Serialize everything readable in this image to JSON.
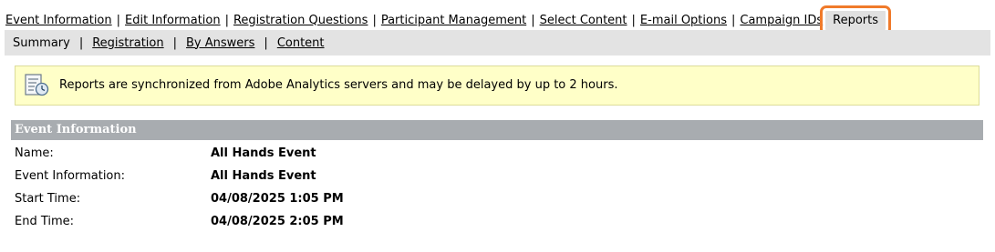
{
  "top_nav": {
    "items": [
      {
        "label": "Event Information"
      },
      {
        "label": "Edit Information"
      },
      {
        "label": "Registration Questions"
      },
      {
        "label": "Participant Management"
      },
      {
        "label": "Select Content"
      },
      {
        "label": "E-mail Options"
      },
      {
        "label": "Campaign IDs"
      }
    ],
    "active_label": "Reports",
    "highlight_color": "#f07a2a"
  },
  "sub_nav": {
    "current": "Summary",
    "links": [
      "Registration",
      "By Answers",
      "Content"
    ],
    "separator": "|"
  },
  "notice": {
    "icon": "report-schedule-icon",
    "message": "Reports are synchronized from Adobe Analytics servers and may be delayed by up to 2 hours.",
    "bg_color": "#ffffc8"
  },
  "event_section": {
    "title": "Event Information",
    "rows": [
      {
        "label": "Name:",
        "value": "All Hands Event"
      },
      {
        "label": "Event Information:",
        "value": "All Hands Event"
      },
      {
        "label": "Start Time:",
        "value": "04/08/2025 1:05 PM"
      },
      {
        "label": "End Time:",
        "value": "04/08/2025 2:05 PM"
      }
    ]
  }
}
